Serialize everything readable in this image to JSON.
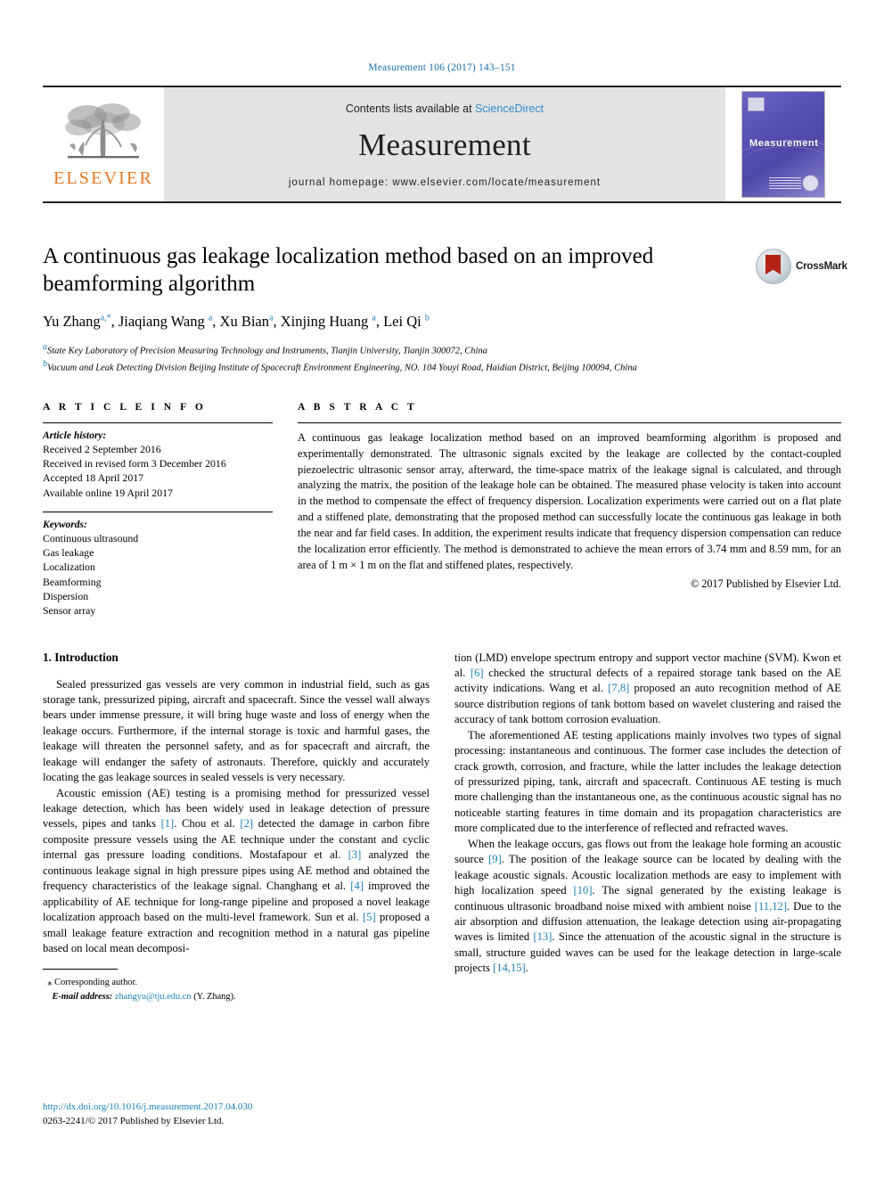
{
  "running_head": "Measurement 106 (2017) 143–151",
  "masthead": {
    "publisher_logo_label": "ELSEVIER",
    "contents_prefix": "Contents lists available at ",
    "contents_link": "ScienceDirect",
    "journal_name": "Measurement",
    "homepage": "journal homepage: www.elsevier.com/locate/measurement",
    "cover_title": "Measurement"
  },
  "article": {
    "title": "A continuous gas leakage localization method based on an improved beamforming algorithm",
    "authors_html": "Yu Zhang<sup>a,*</sup>, Jiaqiang Wang <sup>a</sup>, Xu Bian<sup>a</sup>, Xinjing Huang <sup>a</sup>, Lei Qi <sup>b</sup>",
    "crossmark_label": "CrossMark",
    "affiliations": [
      "a State Key Laboratory of Precision Measuring Technology and Instruments, Tianjin University, Tianjin 300072, China",
      "b Vacuum and Leak Detecting Division Beijing Institute of Spacecraft Environment Engineering, NO. 104 Youyi Road, Haidian District, Beijing 100094, China"
    ]
  },
  "article_info": {
    "heading": "A R T I C L E   I N F O",
    "history_label": "Article history:",
    "history": [
      "Received 2 September 2016",
      "Received in revised form 3 December 2016",
      "Accepted 18 April 2017",
      "Available online 19 April 2017"
    ],
    "keywords_label": "Keywords:",
    "keywords": [
      "Continuous ultrasound",
      "Gas leakage",
      "Localization",
      "Beamforming",
      "Dispersion",
      "Sensor array"
    ]
  },
  "abstract": {
    "heading": "A B S T R A C T",
    "text": "A continuous gas leakage localization method based on an improved beamforming algorithm is proposed and experimentally demonstrated. The ultrasonic signals excited by the leakage are collected by the contact-coupled piezoelectric ultrasonic sensor array, afterward, the time-space matrix of the leakage signal is calculated, and through analyzing the matrix, the position of the leakage hole can be obtained. The measured phase velocity is taken into account in the method to compensate the effect of frequency dispersion. Localization experiments were carried out on a flat plate and a stiffened plate, demonstrating that the proposed method can successfully locate the continuous gas leakage in both the near and far field cases. In addition, the experiment results indicate that frequency dispersion compensation can reduce the localization error efficiently. The method is demonstrated to achieve the mean errors of 3.74 mm and 8.59 mm, for an area of 1 m × 1 m on the flat and stiffened plates, respectively.",
    "copyright": "© 2017 Published by Elsevier Ltd."
  },
  "introduction": {
    "heading": "1. Introduction",
    "left_paragraphs_html": [
      "Sealed pressurized gas vessels are very common in industrial field, such as gas storage tank, pressurized piping, aircraft and spacecraft. Since the vessel wall always bears under immense pressure, it will bring huge waste and loss of energy when the leakage occurs. Furthermore, if the internal storage is toxic and harmful gases, the leakage will threaten the personnel safety, and as for spacecraft and aircraft, the leakage will endanger the safety of astronauts. Therefore, quickly and accurately locating the gas leakage sources in sealed vessels is very necessary.",
      "Acoustic emission (AE) testing is a promising method for pressurized vessel leakage detection, which has been widely used in leakage detection of pressure vessels, pipes and tanks <span class=\"ref\">[1]</span>. Chou et al. <span class=\"ref\">[2]</span> detected the damage in carbon fibre composite pressure vessels using the AE technique under the constant and cyclic internal gas pressure loading conditions. Mostafapour et al. <span class=\"ref\">[3]</span> analyzed the continuous leakage signal in high pressure pipes using AE method and obtained the frequency characteristics of the leakage signal. Changhang et al. <span class=\"ref\">[4]</span> improved the applicability of AE technique for long-range pipeline and proposed a novel leakage localization approach based on the multi-level framework. Sun et al. <span class=\"ref\">[5]</span> proposed a small leakage feature extraction and recognition method in a natural gas pipeline based on local mean decomposi-"
    ],
    "right_paragraphs_html": [
      "tion (LMD) envelope spectrum entropy and support vector machine (SVM). Kwon et al. <span class=\"ref\">[6]</span> checked the structural defects of a repaired storage tank based on the AE activity indications. Wang et al. <span class=\"ref\">[7,8]</span> proposed an auto recognition method of AE source distribution regions of tank bottom based on wavelet clustering and raised the accuracy of tank bottom corrosion evaluation.",
      "The aforementioned AE testing applications mainly involves two types of signal processing: instantaneous and continuous. The former case includes the detection of crack growth, corrosion, and fracture, while the latter includes the leakage detection of pressurized piping, tank, aircraft and spacecraft. Continuous AE testing is much more challenging than the instantaneous one, as the continuous acoustic signal has no noticeable starting features in time domain and its propagation characteristics are more complicated due to the interference of reflected and refracted waves.",
      "When the leakage occurs, gas flows out from the leakage hole forming an acoustic source <span class=\"ref\">[9]</span>. The position of the leakage source can be located by dealing with the leakage acoustic signals. Acoustic localization methods are easy to implement with high localization speed <span class=\"ref\">[10]</span>. The signal generated by the existing leakage is continuous ultrasonic broadband noise mixed with ambient noise <span class=\"ref\">[11,12]</span>. Due to the air absorption and diffusion attenuation, the leakage detection using air-propagating waves is limited <span class=\"ref\">[13]</span>. Since the attenuation of the acoustic signal in the structure is small, structure guided waves can be used for the leakage detection in large-scale projects <span class=\"ref\">[14,15]</span>."
    ]
  },
  "footnote": {
    "corresponding_marker": "⁎",
    "corresponding_text": "Corresponding author.",
    "email_label": "E-mail address:",
    "email": "zhangyu@tju.edu.cn",
    "email_owner": "(Y. Zhang)."
  },
  "page_footer": {
    "doi": "http://dx.doi.org/10.1016/j.measurement.2017.04.030",
    "issn_line": "0263-2241/© 2017 Published by Elsevier Ltd."
  },
  "colors": {
    "link_blue": "#1a7fb5",
    "sciencedirect_blue": "#2f8ccc",
    "elsevier_orange": "#e87722",
    "rule_black": "#231f20"
  }
}
